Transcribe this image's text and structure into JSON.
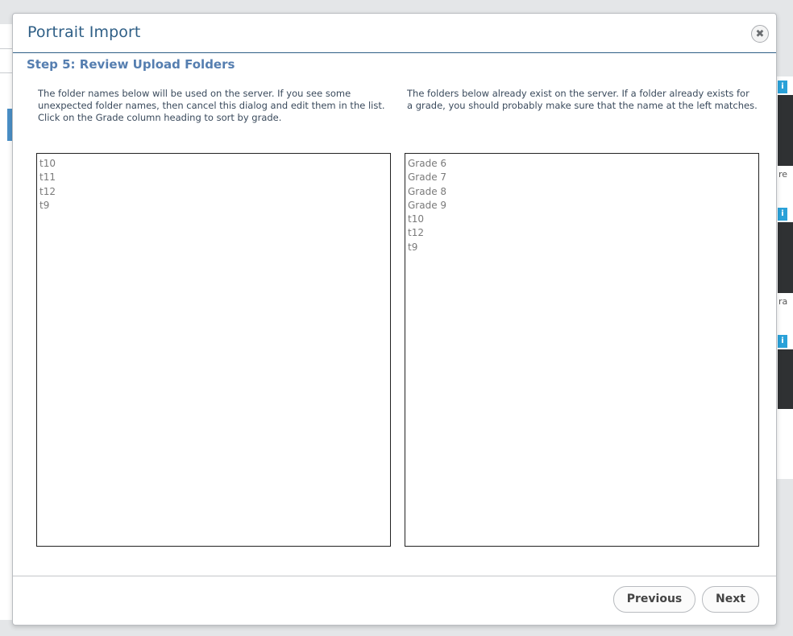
{
  "dialog": {
    "title": "Portrait Import",
    "close_glyph": "✖",
    "step_heading": "Step 5: Review Upload Folders",
    "left_description": "The folder names below will be used on the server. If you see some unexpected folder names, then cancel this dialog and edit them in the list. Click on the Grade column heading to sort by grade.",
    "right_description": "The folders below already exist on the server. If a folder already exists for a grade, you should probably make sure that the name at the left matches.",
    "upload_folders": [
      "t10",
      "t11",
      "t12",
      "t9"
    ],
    "existing_folders": [
      "Grade 6",
      "Grade 7",
      "Grade 8",
      "Grade 9",
      "t10",
      "t12",
      "t9"
    ],
    "buttons": {
      "previous": "Previous",
      "next": "Next"
    }
  },
  "background": {
    "badge_glyph": "i",
    "edge_chars": [
      "re",
      "ra"
    ],
    "thumbnail_color": "#2f3133",
    "badge_color": "#2aa1d8"
  },
  "colors": {
    "title": "#2f5f86",
    "step_heading": "#557eb0",
    "list_text": "#7a7a7a"
  },
  "icons": {
    "close": "close-icon"
  }
}
